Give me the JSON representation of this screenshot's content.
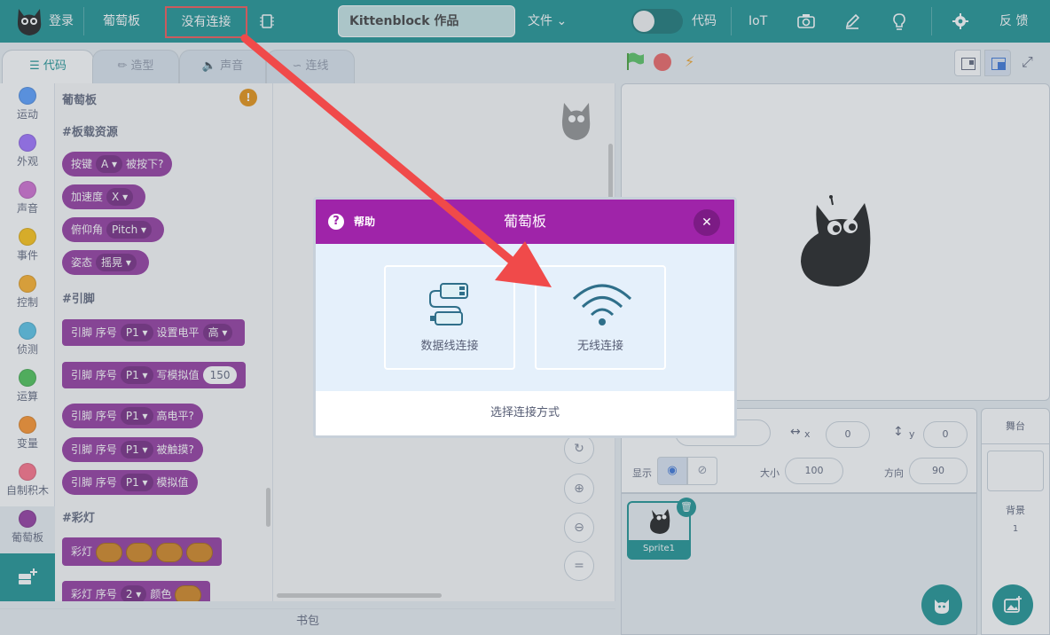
{
  "menubar": {
    "login": "登录",
    "board": "葡萄板",
    "connection": "没有连接",
    "project_title": "Kittenblock 作品",
    "file": "文件",
    "code": "代码",
    "iot": "IoT",
    "feedback": "反 馈"
  },
  "tabs": [
    "代码",
    "造型",
    "声音",
    "连线"
  ],
  "categories": [
    {
      "label": "运动",
      "color": "#4c97ff"
    },
    {
      "label": "外观",
      "color": "#9966ff"
    },
    {
      "label": "声音",
      "color": "#cf63cf"
    },
    {
      "label": "事件",
      "color": "#ffbf00"
    },
    {
      "label": "控制",
      "color": "#ffab19"
    },
    {
      "label": "侦测",
      "color": "#4cbfe6"
    },
    {
      "label": "运算",
      "color": "#40bf4a"
    },
    {
      "label": "变量",
      "color": "#ff8c1a"
    },
    {
      "label": "自制积木",
      "color": "#ff6680"
    },
    {
      "label": "葡萄板",
      "color": "#8d2b9a"
    }
  ],
  "flyout": {
    "title": "葡萄板",
    "section_board": "#板载资源",
    "section_pin": "#引脚",
    "section_led": "#彩灯",
    "blocks": {
      "button": {
        "a": "按键",
        "opt": "A",
        "b": "被按下?"
      },
      "accel": {
        "a": "加速度",
        "opt": "X"
      },
      "pitch": {
        "a": "俯仰角",
        "opt": "Pitch"
      },
      "pose": {
        "a": "姿态",
        "opt": "摇晃"
      },
      "pin_level": {
        "a": "引脚 序号",
        "opt": "P1",
        "b": "设置电平",
        "opt2": "高"
      },
      "pin_analog_write": {
        "a": "引脚 序号",
        "opt": "P1",
        "b": "写模拟值",
        "num": "150"
      },
      "pin_high": {
        "a": "引脚 序号",
        "opt": "P1",
        "b": "高电平?"
      },
      "pin_touch": {
        "a": "引脚 序号",
        "opt": "P1",
        "b": "被触摸?"
      },
      "pin_analog": {
        "a": "引脚 序号",
        "opt": "P1",
        "b": "模拟值"
      },
      "led": {
        "a": "彩灯"
      },
      "led_index": {
        "a": "彩灯 序号",
        "opt": "2",
        "b": "颜色"
      }
    }
  },
  "bookbag": "书包",
  "sprite_info": {
    "x_value": "0",
    "y_label": "y",
    "y_value": "0",
    "show_label": "显示",
    "size_label": "大小",
    "size_value": "100",
    "direction_label": "方向",
    "direction_value": "90",
    "sprite_name": "Sprite1"
  },
  "stage_panel": {
    "title": "舞台",
    "backdrop_label": "背景",
    "backdrop_count": "1"
  },
  "modal": {
    "help": "帮助",
    "title": "葡萄板",
    "option_usb": "数据线连接",
    "option_wireless": "无线连接",
    "footer": "选择连接方式"
  },
  "colors": {
    "teal": "#0e8b8b",
    "purple": "#9f24a9",
    "block": "#8d2b9a",
    "annotation_red": "#f04a4a"
  }
}
